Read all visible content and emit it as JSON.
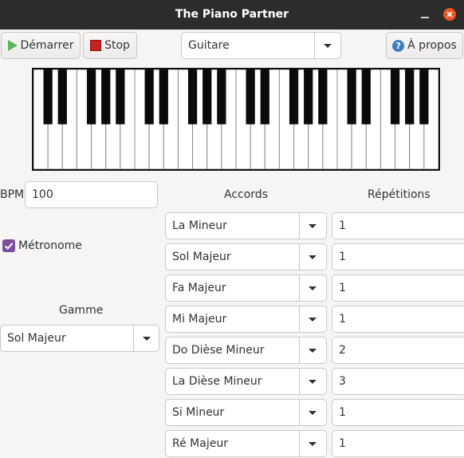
{
  "window": {
    "title": "The Piano Partner"
  },
  "toolbar": {
    "start_label": "Démarrer",
    "stop_label": "Stop",
    "instrument": "Guitare",
    "about_label": "À propos",
    "about_icon": "help-icon"
  },
  "piano": {
    "octaves": 4,
    "white_keys": 28,
    "black_keys": 20
  },
  "settings": {
    "bpm_label": "BPM",
    "bpm_value": "100",
    "metronome_label": "Métronome",
    "metronome_checked": true,
    "scale_label": "Gamme",
    "scale_value": "Sol Majeur"
  },
  "columns": {
    "chords": "Accords",
    "repetitions": "Répétitions"
  },
  "rows": [
    {
      "chord": "La Mineur",
      "repetitions": "1"
    },
    {
      "chord": "Sol Majeur",
      "repetitions": "1"
    },
    {
      "chord": "Fa Majeur",
      "repetitions": "1"
    },
    {
      "chord": "Mi Majeur",
      "repetitions": "1"
    },
    {
      "chord": "Do Dièse Mineur",
      "repetitions": "2"
    },
    {
      "chord": "La Dièse Mineur",
      "repetitions": "3"
    },
    {
      "chord": "Si Mineur",
      "repetitions": "1"
    },
    {
      "chord": "Ré Majeur",
      "repetitions": "1"
    }
  ],
  "colors": {
    "titlebar": "#2c2c2c",
    "close": "#e95420",
    "check": "#7b4ea0",
    "play": "#5cb85c",
    "stop": "#cc1f1f"
  }
}
